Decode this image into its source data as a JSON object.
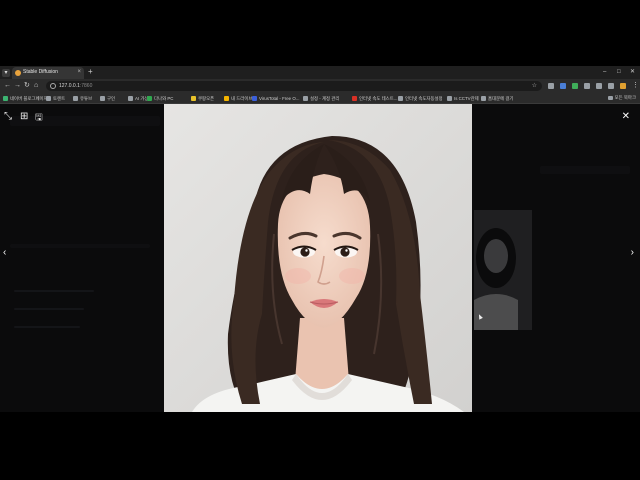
{
  "browser": {
    "tab_title": "Stable Diffusion",
    "tab_close": "×",
    "new_tab": "+",
    "window_controls": {
      "minimize": "–",
      "maximize": "□",
      "close": "✕"
    },
    "nav": {
      "back": "←",
      "forward": "→",
      "reload": "↻",
      "home": "⌂"
    },
    "url_host": "127.0.0.1",
    "url_path": ":7860",
    "star": "☆",
    "menu": "⋮",
    "extensions": [
      {
        "icon": "pen-icon",
        "color": "#9aa0a6"
      },
      {
        "icon": "translate-icon",
        "color": "#4a7fd8"
      },
      {
        "icon": "shield-icon",
        "color": "#3fae5a"
      },
      {
        "icon": "puzzle-icon",
        "color": "#9aa0a6"
      },
      {
        "icon": "sidebar-icon",
        "color": "#9aa0a6"
      },
      {
        "icon": "download-icon",
        "color": "#9aa0a6"
      },
      {
        "icon": "avatar-icon",
        "color": "#e0a030"
      }
    ]
  },
  "bookmarks": [
    {
      "label": "네이버 블로그페이지",
      "color": "#3cb371"
    },
    {
      "label": "토렌트",
      "color": "#9aa0a6"
    },
    {
      "label": "유튜브",
      "color": "#9aa0a6"
    },
    {
      "label": "구인",
      "color": "#9aa0a6"
    },
    {
      "label": "AI 가상",
      "color": "#9aa0a6"
    },
    {
      "label": "다나와 PC",
      "color": "#2fa84f"
    },
    {
      "label": "쿠팡오픈",
      "color": "#e8c22a"
    },
    {
      "label": "내 드라이브",
      "color": "#f4b400"
    },
    {
      "label": "VirusTotal - Free O...",
      "color": "#3b5fd9"
    },
    {
      "label": "설정 - 계정 관리",
      "color": "#9aa0a6"
    },
    {
      "label": "인터넷 속도 테스트...",
      "color": "#d93025"
    },
    {
      "label": "인터넷 속도자동설정",
      "color": "#9aa0a6"
    },
    {
      "label": "Is CCTV관제",
      "color": "#9aa0a6"
    },
    {
      "label": "홈대문에 걸기",
      "color": "#9aa0a6"
    }
  ],
  "bookmarks_all": "모든 북마크",
  "lightbox": {
    "fullscreen_icon": "⤡",
    "tile_icon": "⊞",
    "save_icon": "🖫",
    "close_icon": "✕",
    "prev_icon": "‹",
    "next_icon": "›"
  }
}
